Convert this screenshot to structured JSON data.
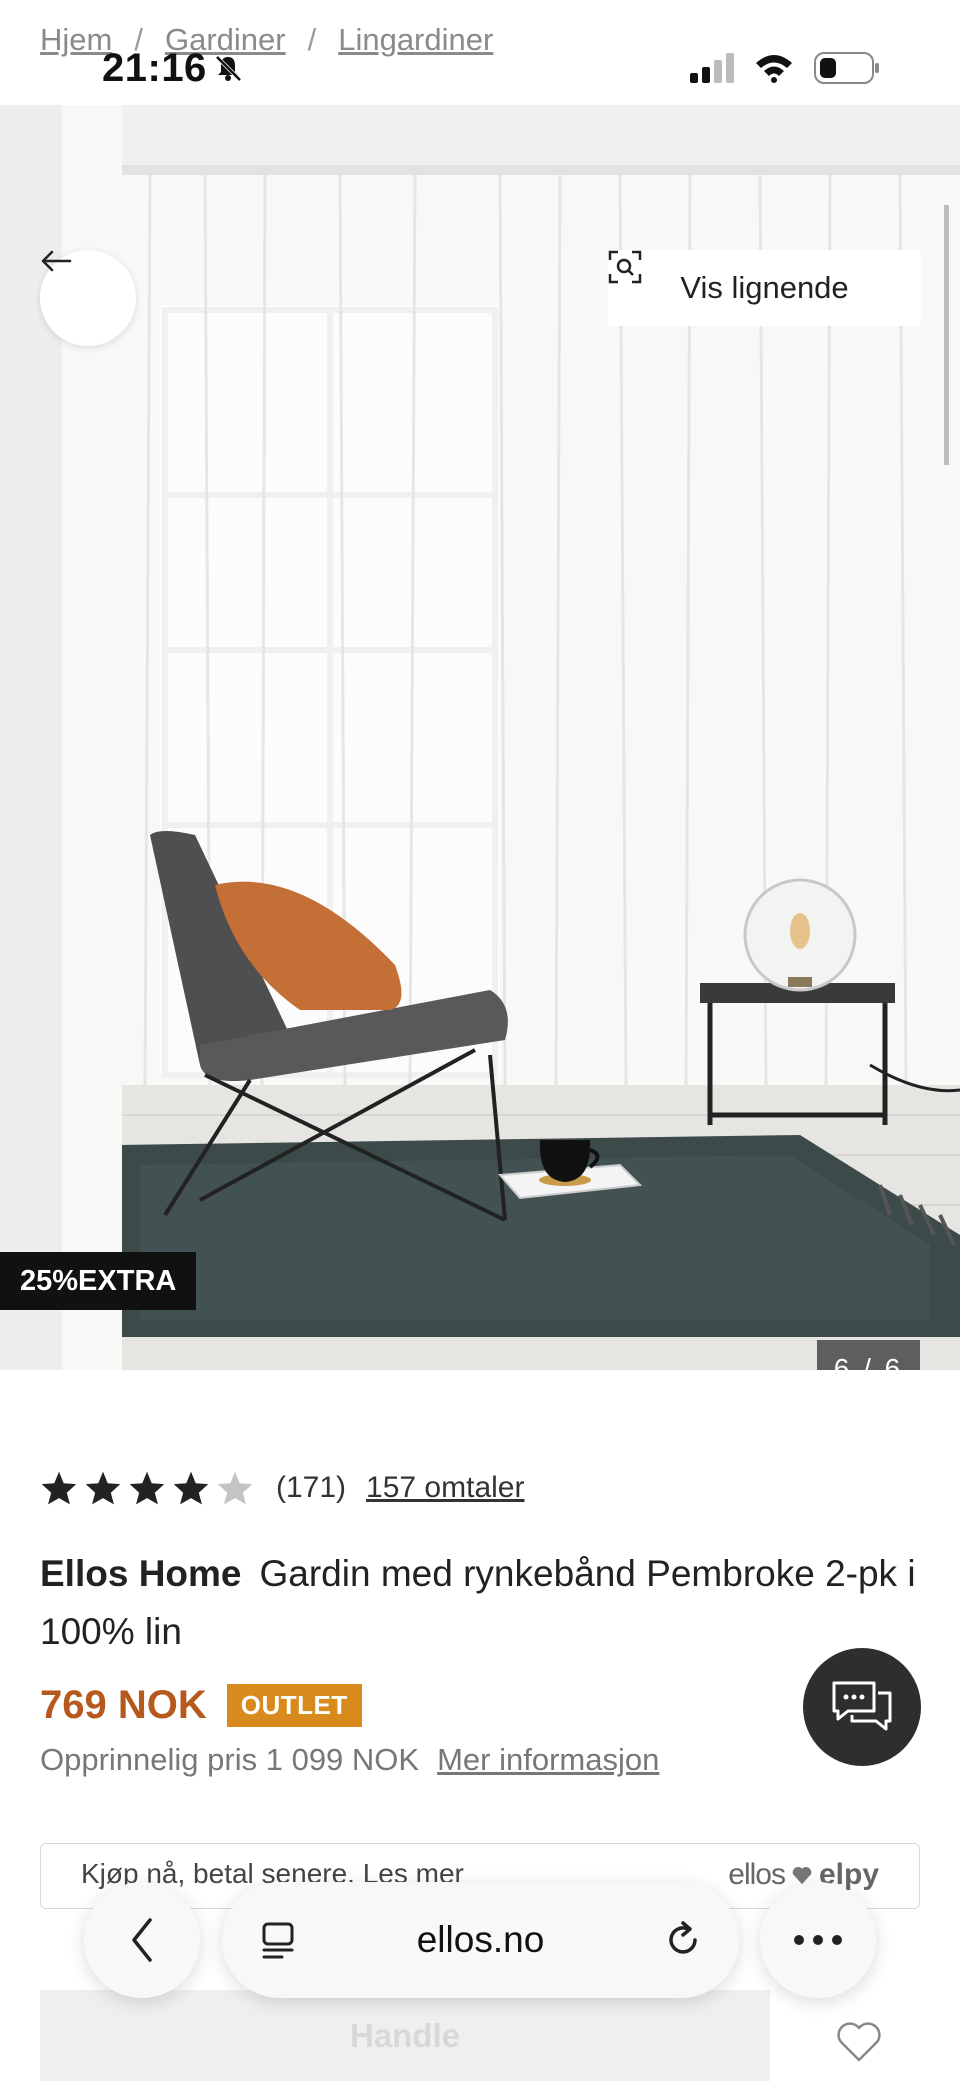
{
  "breadcrumb": [
    "Hjem",
    "Gardiner",
    "Lingardiner"
  ],
  "breadcrumb_separator": "/",
  "status_bar": {
    "time": "21:16"
  },
  "gallery": {
    "similar_button": "Vis lignende",
    "promo_badge": "25%EXTRA",
    "counter": "6 / 6"
  },
  "rating": {
    "stars_filled": 4,
    "stars_total": 5,
    "count": "(171)",
    "reviews_link": "157 omtaler"
  },
  "product": {
    "brand": "Ellos Home",
    "name": "Gardin med rynkebånd Pembroke 2-pk i 100% lin"
  },
  "price": {
    "current": "769 NOK",
    "badge": "OUTLET",
    "original": "Opprinnelig pris 1 099 NOK",
    "more_info": "Mer informasjon"
  },
  "payment": {
    "text": "Kjøp nå, betal senere. Les mer",
    "brand_left": "ellos",
    "brand_right": "elpy"
  },
  "buy_button": "Handle",
  "browser": {
    "url": "ellos.no"
  },
  "colors": {
    "price": "#b6591d",
    "outlet_badge": "#d98a1c",
    "chat_button": "#2e2e2e"
  }
}
